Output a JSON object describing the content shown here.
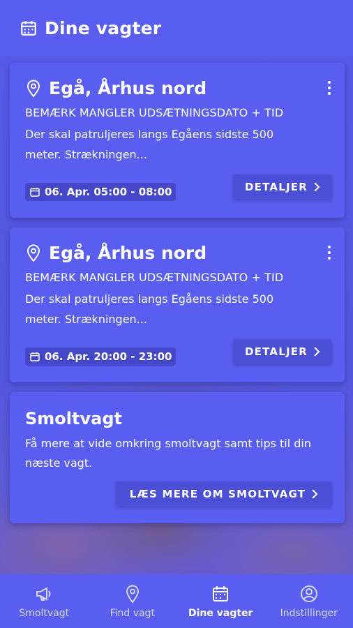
{
  "header": {
    "title": "Dine vagter",
    "icon": "calendar-icon"
  },
  "shifts": [
    {
      "location": "Egå, Århus nord",
      "notice": "BEMÆRK MANGLER UDSÆTNINGSDATO + TID",
      "description": "Der skal patruljeres langs Egåens sidste 500 meter. Strækningen...",
      "date": "06. Apr. 05:00 - 08:00",
      "details_label": "DETALJER"
    },
    {
      "location": "Egå, Århus nord",
      "notice": "BEMÆRK MANGLER UDSÆTNINGSDATO + TID",
      "description": "Der skal patruljeres langs Egåens sidste 500 meter. Strækningen...",
      "date": "06. Apr. 20:00 - 23:00",
      "details_label": "DETALJER"
    }
  ],
  "promo": {
    "title": "Smoltvagt",
    "text": "Få mere at vide omkring smoltvagt samt tips til din næste vagt.",
    "button_label": "LÆS MERE OM SMOLTVAGT"
  },
  "nav": {
    "items": [
      {
        "label": "Smoltvagt",
        "icon": "megaphone-icon",
        "active": false
      },
      {
        "label": "Find vagt",
        "icon": "location-pin-icon",
        "active": false
      },
      {
        "label": "Dine vagter",
        "icon": "calendar-icon",
        "active": true
      },
      {
        "label": "Indstillinger",
        "icon": "user-circle-icon",
        "active": false
      }
    ]
  },
  "colors": {
    "primary": "#5a5ef0",
    "chip": "#4347c8",
    "button": "#4b4fd6",
    "text": "#ffffff"
  }
}
